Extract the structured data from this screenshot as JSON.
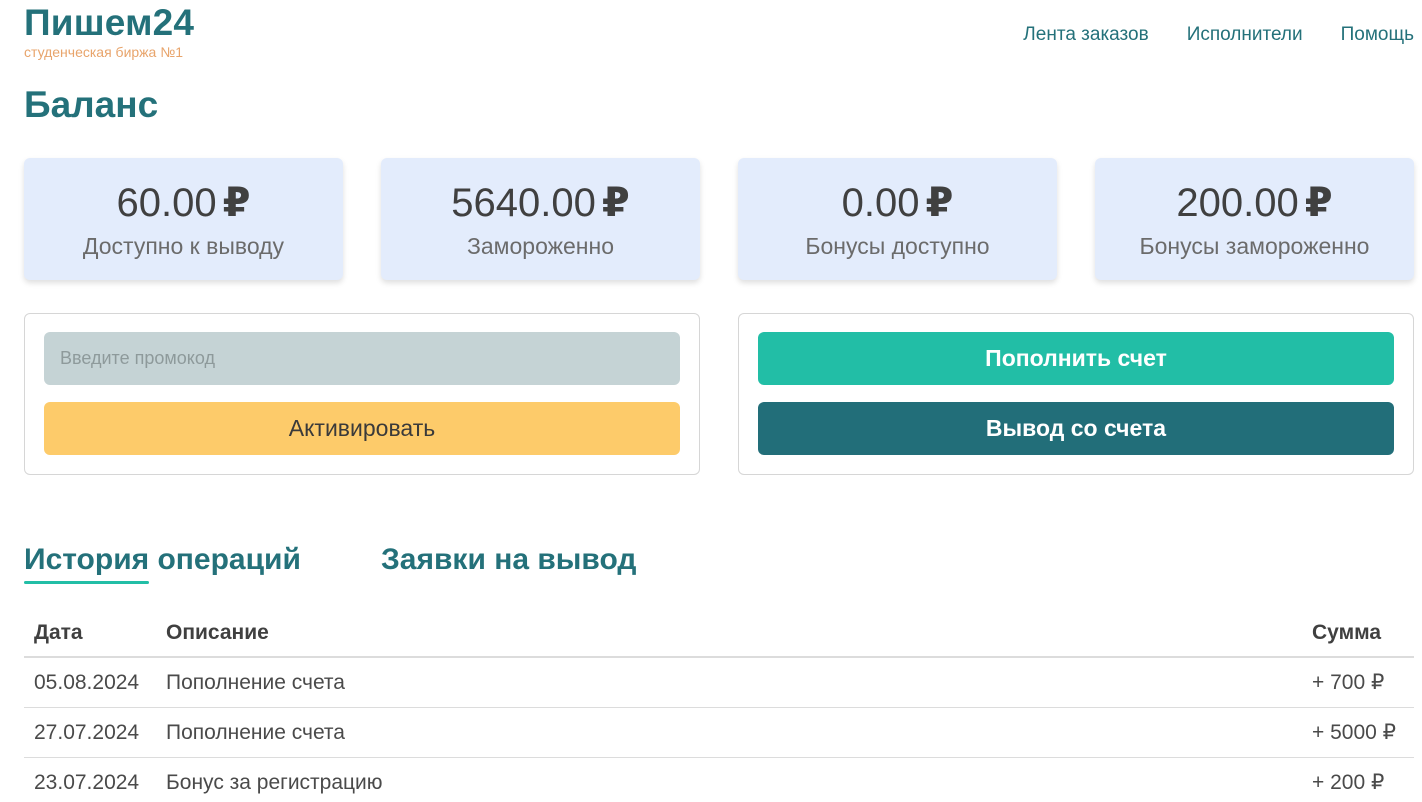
{
  "header": {
    "logo_title": "Пишем24",
    "logo_subtitle": "студенческая биржа №1",
    "nav": [
      "Лента заказов",
      "Исполнители",
      "Помощь"
    ]
  },
  "page_title": "Баланс",
  "currency_symbol": "₽",
  "cards": [
    {
      "amount": "60.00",
      "label": "Доступно к выводу"
    },
    {
      "amount": "5640.00",
      "label": "Замороженно"
    },
    {
      "amount": "0.00",
      "label": "Бонусы доступно"
    },
    {
      "amount": "200.00",
      "label": "Бонусы замороженно"
    }
  ],
  "promo": {
    "placeholder": "Введите промокод",
    "value": "",
    "activate_label": "Активировать"
  },
  "actions": {
    "topup_label": "Пополнить счет",
    "withdraw_label": "Вывод со счета"
  },
  "tabs": [
    {
      "label": "История операций",
      "active": true
    },
    {
      "label": "Заявки на вывод",
      "active": false
    }
  ],
  "table": {
    "headers": {
      "date": "Дата",
      "description": "Описание",
      "sum": "Сумма"
    },
    "rows": [
      {
        "date": "05.08.2024",
        "description": "Пополнение счета",
        "sum": "+ 700 ₽"
      },
      {
        "date": "27.07.2024",
        "description": "Пополнение счета",
        "sum": "+ 5000 ₽"
      },
      {
        "date": "23.07.2024",
        "description": "Бонус за регистрацию",
        "sum": "+ 200 ₽"
      }
    ]
  },
  "colors": {
    "brand": "#24717a",
    "accent": "#22bea6",
    "logo_subtitle": "#e8a46b",
    "card_bg": "#e3ecfc",
    "activate_button": "#fdcb6a",
    "withdraw_button": "#226e79",
    "promo_input_bg": "#c5d3d5"
  }
}
